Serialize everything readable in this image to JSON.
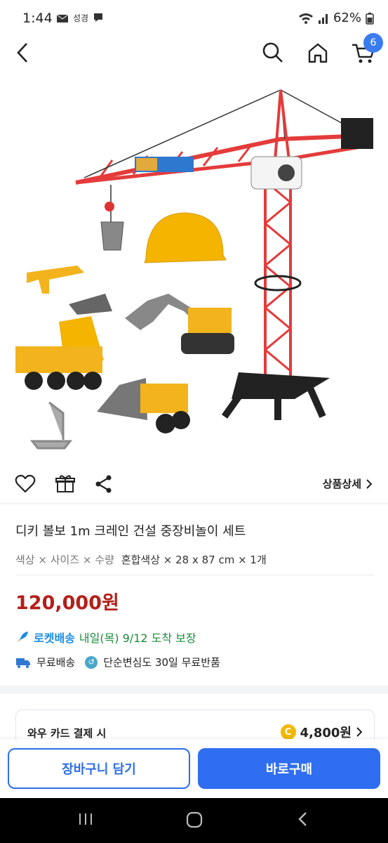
{
  "status_bar": {
    "time": "1:44",
    "notif_text": "성경",
    "battery": "62%"
  },
  "cart_badge": "6",
  "icons": {
    "back": "chevron-left-icon",
    "search": "search-icon",
    "home": "home-icon",
    "cart": "cart-icon",
    "like": "heart-icon",
    "gift": "gift-icon",
    "share": "share-icon"
  },
  "product": {
    "detail_link": "상품상세",
    "title": "디키 볼보 1m 크레인 건설 중장비놀이 세트",
    "options_label": "색상 × 사이즈 × 수량",
    "options_value": "혼합색상 × 28 x 87 cm × 1개",
    "price": "120,000원"
  },
  "delivery": {
    "rocket_brand": "로켓배송",
    "rocket_eta": "내일(목) 9/12 도착 보장",
    "free_shipping": "무료배송",
    "free_return": "단순변심도 30일 무료반품"
  },
  "wow": {
    "label": "와우 카드 결제 시",
    "coin": "C",
    "amount": "4,800원"
  },
  "buttons": {
    "add_to_cart": "장바구니 담기",
    "buy_now": "바로구매"
  },
  "colors": {
    "accent": "#2f6ef0",
    "price": "#b3201a",
    "rocket": "#1a8d3a"
  }
}
